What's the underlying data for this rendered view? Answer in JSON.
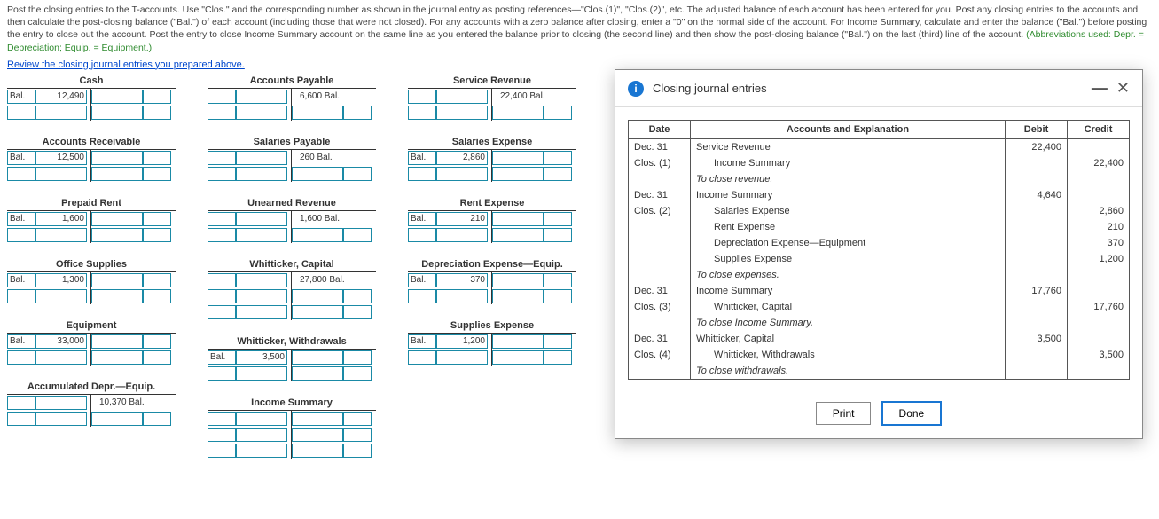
{
  "instructions": "Post the closing entries to the T-accounts. Use \"Clos.\" and the corresponding number as shown in the journal entry as posting references—\"Clos.(1)\", \"Clos.(2)\", etc. The adjusted balance of each account has been entered for you. Post any closing entries to the accounts and then calculate the post-closing balance (\"Bal.\") of each account (including those that were not closed). For any accounts with a zero balance after closing, enter a \"0\" on the normal side of the account. For Income Summary, calculate and enter the balance (\"Bal.\") before posting the entry to close out the account. Post the entry to close Income Summary account on the same line as you entered the balance prior to closing (the second line) and then show the post-closing balance (\"Bal.\") on the last (third) line of the account. ",
  "abbrev": "(Abbreviations used: Depr. = Depreciation; Equip. = Equipment.)",
  "review_link": "Review the closing journal entries you prepared above.",
  "bal": "Bal.",
  "accounts": {
    "cash": {
      "title": "Cash",
      "left_val": "12,490"
    },
    "ar": {
      "title": "Accounts Receivable",
      "left_val": "12,500"
    },
    "prep": {
      "title": "Prepaid Rent",
      "left_val": "1,600"
    },
    "sup": {
      "title": "Office Supplies",
      "left_val": "1,300"
    },
    "equip": {
      "title": "Equipment",
      "left_val": "33,000"
    },
    "acdep": {
      "title": "Accumulated Depr.—Equip.",
      "right_val": "10,370 Bal."
    },
    "ap": {
      "title": "Accounts Payable",
      "right_val": "6,600 Bal."
    },
    "sp": {
      "title": "Salaries Payable",
      "right_val": "260 Bal."
    },
    "ur": {
      "title": "Unearned Revenue",
      "right_val": "1,600 Bal."
    },
    "cap": {
      "title": "Whitticker, Capital",
      "right_val": "27,800 Bal."
    },
    "wd": {
      "title": "Whitticker, Withdrawals",
      "left_val": "3,500"
    },
    "is": {
      "title": "Income Summary"
    },
    "srev": {
      "title": "Service Revenue",
      "right_val": "22,400 Bal."
    },
    "salex": {
      "title": "Salaries Expense",
      "left_val": "2,860"
    },
    "rentex": {
      "title": "Rent Expense",
      "left_val": "210"
    },
    "depex": {
      "title": "Depreciation Expense—Equip.",
      "left_val": "370"
    },
    "supex": {
      "title": "Supplies Expense",
      "left_val": "1,200"
    }
  },
  "modal": {
    "title": "Closing journal entries",
    "cols": {
      "date": "Date",
      "acct": "Accounts and Explanation",
      "debit": "Debit",
      "credit": "Credit"
    },
    "print": "Print",
    "done": "Done"
  },
  "journal": [
    {
      "date": "Dec. 31",
      "acct": "Service Revenue",
      "debit": "22,400",
      "credit": ""
    },
    {
      "date": "Clos. (1)",
      "acct": "Income Summary",
      "indent": true,
      "debit": "",
      "credit": "22,400"
    },
    {
      "date": "",
      "acct": "To close revenue.",
      "italic": true,
      "debit": "",
      "credit": ""
    },
    {
      "date": "Dec. 31",
      "acct": "Income Summary",
      "debit": "4,640",
      "credit": ""
    },
    {
      "date": "Clos. (2)",
      "acct": "Salaries Expense",
      "indent": true,
      "debit": "",
      "credit": "2,860"
    },
    {
      "date": "",
      "acct": "Rent Expense",
      "indent": true,
      "debit": "",
      "credit": "210"
    },
    {
      "date": "",
      "acct": "Depreciation Expense—Equipment",
      "indent": true,
      "debit": "",
      "credit": "370"
    },
    {
      "date": "",
      "acct": "Supplies Expense",
      "indent": true,
      "debit": "",
      "credit": "1,200"
    },
    {
      "date": "",
      "acct": "To close expenses.",
      "italic": true,
      "debit": "",
      "credit": ""
    },
    {
      "date": "Dec. 31",
      "acct": "Income Summary",
      "debit": "17,760",
      "credit": ""
    },
    {
      "date": "Clos. (3)",
      "acct": "Whitticker, Capital",
      "indent": true,
      "debit": "",
      "credit": "17,760"
    },
    {
      "date": "",
      "acct": "To close Income Summary.",
      "italic": true,
      "debit": "",
      "credit": ""
    },
    {
      "date": "Dec. 31",
      "acct": "Whitticker, Capital",
      "debit": "3,500",
      "credit": ""
    },
    {
      "date": "Clos. (4)",
      "acct": "Whitticker, Withdrawals",
      "indent": true,
      "debit": "",
      "credit": "3,500"
    },
    {
      "date": "",
      "acct": "To close withdrawals.",
      "italic": true,
      "debit": "",
      "credit": ""
    }
  ]
}
